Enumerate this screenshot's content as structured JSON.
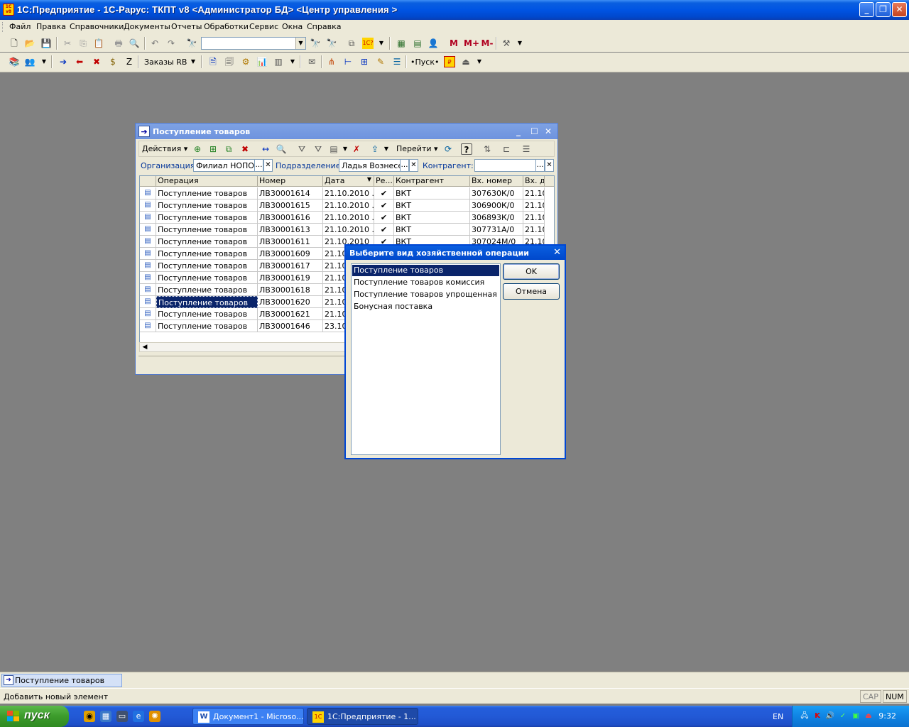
{
  "window": {
    "title": "1С:Предприятие - 1С-Рарус: ТКПТ v8 <Администратор БД> <Центр управления >",
    "icon_label": "1С\nv8"
  },
  "menu": [
    "Файл",
    "Правка",
    "Справочники",
    "Документы",
    "Отчеты",
    "Обработки",
    "Сервис",
    "Окна",
    "Справка"
  ],
  "toolbar1": {
    "search_value": "",
    "m_label": "M",
    "mplus_label": "M+",
    "mminus_label": "M-"
  },
  "toolbar2": {
    "orders_label": "Заказы RB",
    "start_label": "•Пуск•"
  },
  "doc_window": {
    "title": "Поступление товаров",
    "actions_label": "Действия",
    "goto_label": "Перейти",
    "filter": {
      "org_label": "Организация:",
      "org_value": "Филиал НОПО",
      "dept_label": "Подразделение:",
      "dept_value": "Ладья Вознесен",
      "contractor_label": "Контрагент:",
      "contractor_value": ""
    },
    "columns": [
      "Операция",
      "Номер",
      "Дата",
      "Ре...",
      "Контрагент",
      "Вх. номер",
      "Вх. да"
    ],
    "rows": [
      {
        "op": "Поступление товаров",
        "num": "ЛВ30001614",
        "date": "21.10.2010 ...",
        "posted": "✔",
        "contractor": "ВКТ",
        "in_num": "307630К/0",
        "in_date": "21.10"
      },
      {
        "op": "Поступление товаров",
        "num": "ЛВ30001615",
        "date": "21.10.2010 ...",
        "posted": "✔",
        "contractor": "ВКТ",
        "in_num": "306900К/0",
        "in_date": "21.10"
      },
      {
        "op": "Поступление товаров",
        "num": "ЛВ30001616",
        "date": "21.10.2010 ...",
        "posted": "✔",
        "contractor": "ВКТ",
        "in_num": "306893К/0",
        "in_date": "21.10"
      },
      {
        "op": "Поступление товаров",
        "num": "ЛВ30001613",
        "date": "21.10.2010 ...",
        "posted": "✔",
        "contractor": "ВКТ",
        "in_num": "307731А/0",
        "in_date": "21.10"
      },
      {
        "op": "Поступление товаров",
        "num": "ЛВ30001611",
        "date": "21.10.2010",
        "posted": "✔",
        "contractor": "ВКТ",
        "in_num": "307024М/0",
        "in_date": "21.10"
      },
      {
        "op": "Поступление товаров",
        "num": "ЛВ30001609",
        "date": "21.10",
        "posted": "",
        "contractor": "",
        "in_num": "",
        "in_date": ""
      },
      {
        "op": "Поступление товаров",
        "num": "ЛВ30001617",
        "date": "21.10",
        "posted": "",
        "contractor": "",
        "in_num": "",
        "in_date": ""
      },
      {
        "op": "Поступление товаров",
        "num": "ЛВ30001619",
        "date": "21.10",
        "posted": "",
        "contractor": "",
        "in_num": "",
        "in_date": ""
      },
      {
        "op": "Поступление товаров",
        "num": "ЛВ30001618",
        "date": "21.10",
        "posted": "",
        "contractor": "",
        "in_num": "",
        "in_date": ""
      },
      {
        "op": "Поступление товаров",
        "num": "ЛВ30001620",
        "date": "21.10",
        "posted": "",
        "contractor": "",
        "in_num": "",
        "in_date": ""
      },
      {
        "op": "Поступление товаров",
        "num": "ЛВ30001621",
        "date": "21.10",
        "posted": "",
        "contractor": "",
        "in_num": "",
        "in_date": ""
      },
      {
        "op": "Поступление товаров",
        "num": "ЛВ30001646",
        "date": "23.10",
        "posted": "",
        "contractor": "",
        "in_num": "",
        "in_date": ""
      }
    ],
    "selected_row": 9
  },
  "dialog": {
    "title": "Выберите вид хозяйственной операции",
    "options": [
      "Поступление товаров",
      "Поступление товаров комиссия",
      "Поступление товаров упрощенная ко...",
      "Бонусная поставка"
    ],
    "selected_option": 0,
    "ok_label": "OK",
    "cancel_label": "Отмена"
  },
  "window_tab": {
    "label": "Поступление товаров"
  },
  "statusbar": {
    "text": "Добавить новый элемент",
    "cap": "CAP",
    "num": "NUM"
  },
  "taskbar": {
    "start_label": "пуск",
    "tasks": [
      "Документ1 - Microso...",
      "1С:Предприятие - 1..."
    ],
    "lang": "EN",
    "clock": "9:32"
  }
}
